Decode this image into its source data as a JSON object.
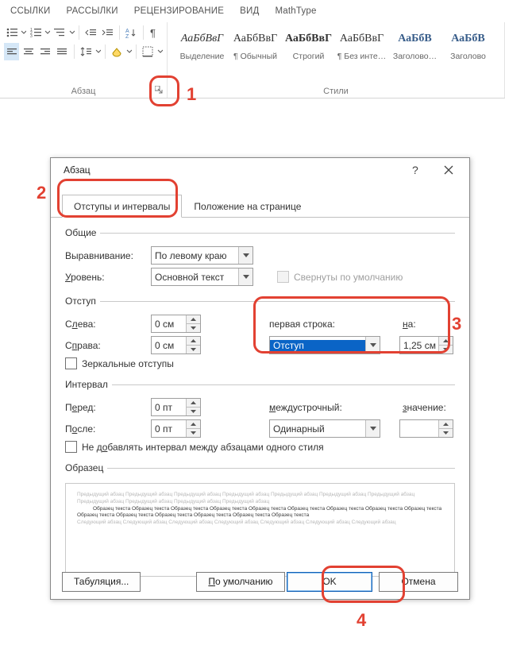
{
  "ribbon": {
    "tabs": [
      "ССЫЛКИ",
      "РАССЫЛКИ",
      "РЕЦЕНЗИРОВАНИЕ",
      "ВИД",
      "MathType"
    ],
    "groups": {
      "paragraph": {
        "label": "Абзац"
      },
      "styles": {
        "label": "Стили",
        "items": [
          {
            "sample": "АаБбВвГ",
            "name": "Выделение",
            "bold": false,
            "italic": true
          },
          {
            "sample": "АаБбВвГ",
            "name": "¶ Обычный",
            "bold": false
          },
          {
            "sample": "АаБбВвГ",
            "name": "Строгий",
            "bold": true
          },
          {
            "sample": "АаБбВвГ",
            "name": "¶ Без инте…",
            "bold": false
          },
          {
            "sample": "АаБбВ",
            "name": "Заголово…",
            "bold": true,
            "color": "#385d8a"
          },
          {
            "sample": "АаБбВ",
            "name": "Заголово",
            "bold": true,
            "color": "#385d8a"
          }
        ]
      }
    }
  },
  "dialog": {
    "title": "Абзац",
    "tabs": {
      "indents": "Отступы и интервалы",
      "position": "Положение на странице"
    },
    "general": {
      "legend": "Общие",
      "alignment_label": "Выравнивание:",
      "alignment_value": "По левому краю",
      "level_label": "Уровень:",
      "level_value": "Основной текст",
      "collapse_label": "Свернуты по умолчанию"
    },
    "indent": {
      "legend": "Отступ",
      "left_label": "Слева:",
      "left_value": "0 см",
      "right_label": "Справа:",
      "right_value": "0 см",
      "first_label": "первая строка:",
      "first_value": "Отступ",
      "by_label": "на:",
      "by_value": "1,25 см",
      "mirror_label": "Зеркальные отступы"
    },
    "spacing": {
      "legend": "Интервал",
      "before_label": "Перед:",
      "before_value": "0 пт",
      "after_label": "После:",
      "after_value": "0 пт",
      "line_label": "междустрочный:",
      "line_value": "Одинарный",
      "at_label": "значение:",
      "at_value": "",
      "nosame_label": "Не добавлять интервал между абзацами одного стиля"
    },
    "preview": {
      "legend": "Образец",
      "light1": "Предыдущий абзац Предыдущий абзац Предыдущий абзац Предыдущий абзац Предыдущий абзац Предыдущий абзац Предыдущий абзац Предыдущий абзац Предыдущий абзац Предыдущий абзац Предыдущий абзац",
      "dark": "Образец текста Образец текста Образец текста Образец текста Образец текста Образец текста Образец текста Образец текста Образец текста Образец текста Образец текста Образец текста Образец текста Образец текста Образец текста",
      "light2": "Следующий абзац Следующий абзац Следующий абзац Следующий абзац Следующий абзац Следующий абзац Следующий абзац"
    },
    "buttons": {
      "tabstops": "Табуляция...",
      "default": "По умолчанию",
      "ok": "OK",
      "cancel": "Отмена"
    }
  },
  "annotations": {
    "n1": "1",
    "n2": "2",
    "n3": "3",
    "n4": "4"
  }
}
